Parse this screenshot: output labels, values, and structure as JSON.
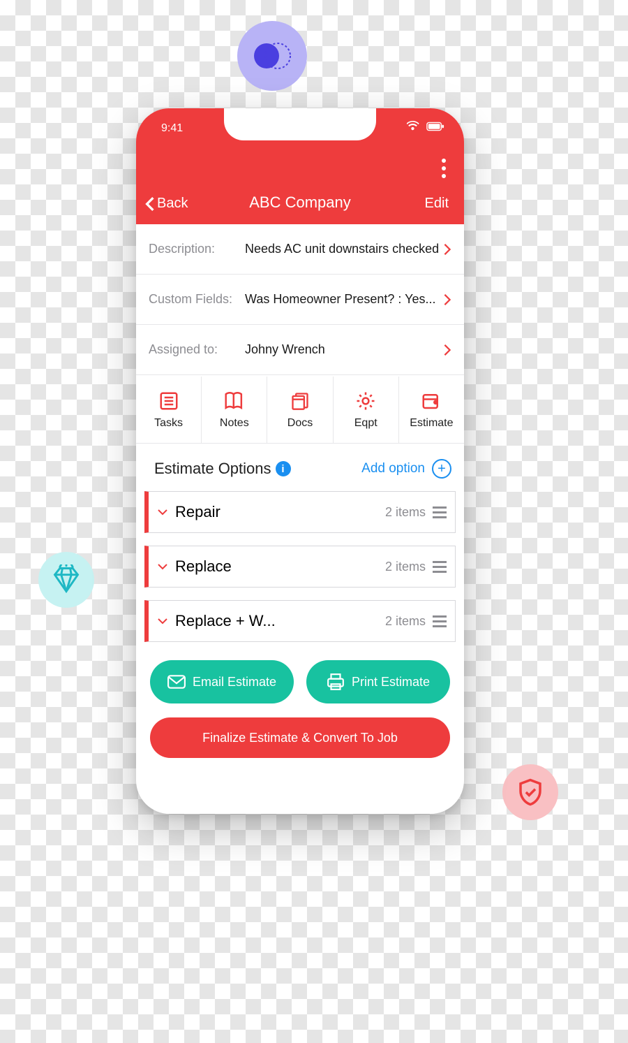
{
  "status": {
    "time": "9:41"
  },
  "nav": {
    "back": "Back",
    "title": "ABC Company",
    "edit": "Edit"
  },
  "rows": {
    "description": {
      "label": "Description:",
      "value": "Needs AC unit downstairs checked"
    },
    "custom": {
      "label": "Custom Fields:",
      "value": "Was Homeowner Present? : Yes..."
    },
    "assigned": {
      "label": "Assigned to:",
      "value": "Johny Wrench"
    }
  },
  "tabs": {
    "tasks": "Tasks",
    "notes": "Notes",
    "docs": "Docs",
    "eqpt": "Eqpt",
    "estimate": "Estimate"
  },
  "estimate": {
    "heading": "Estimate Options",
    "add": "Add option",
    "options": [
      {
        "name": "Repair",
        "count": "2 items"
      },
      {
        "name": "Replace",
        "count": "2 items"
      },
      {
        "name": "Replace + W...",
        "count": "2 items"
      }
    ]
  },
  "buttons": {
    "email": "Email Estimate",
    "print": "Print Estimate",
    "finalize": "Finalize Estimate & Convert To Job"
  }
}
